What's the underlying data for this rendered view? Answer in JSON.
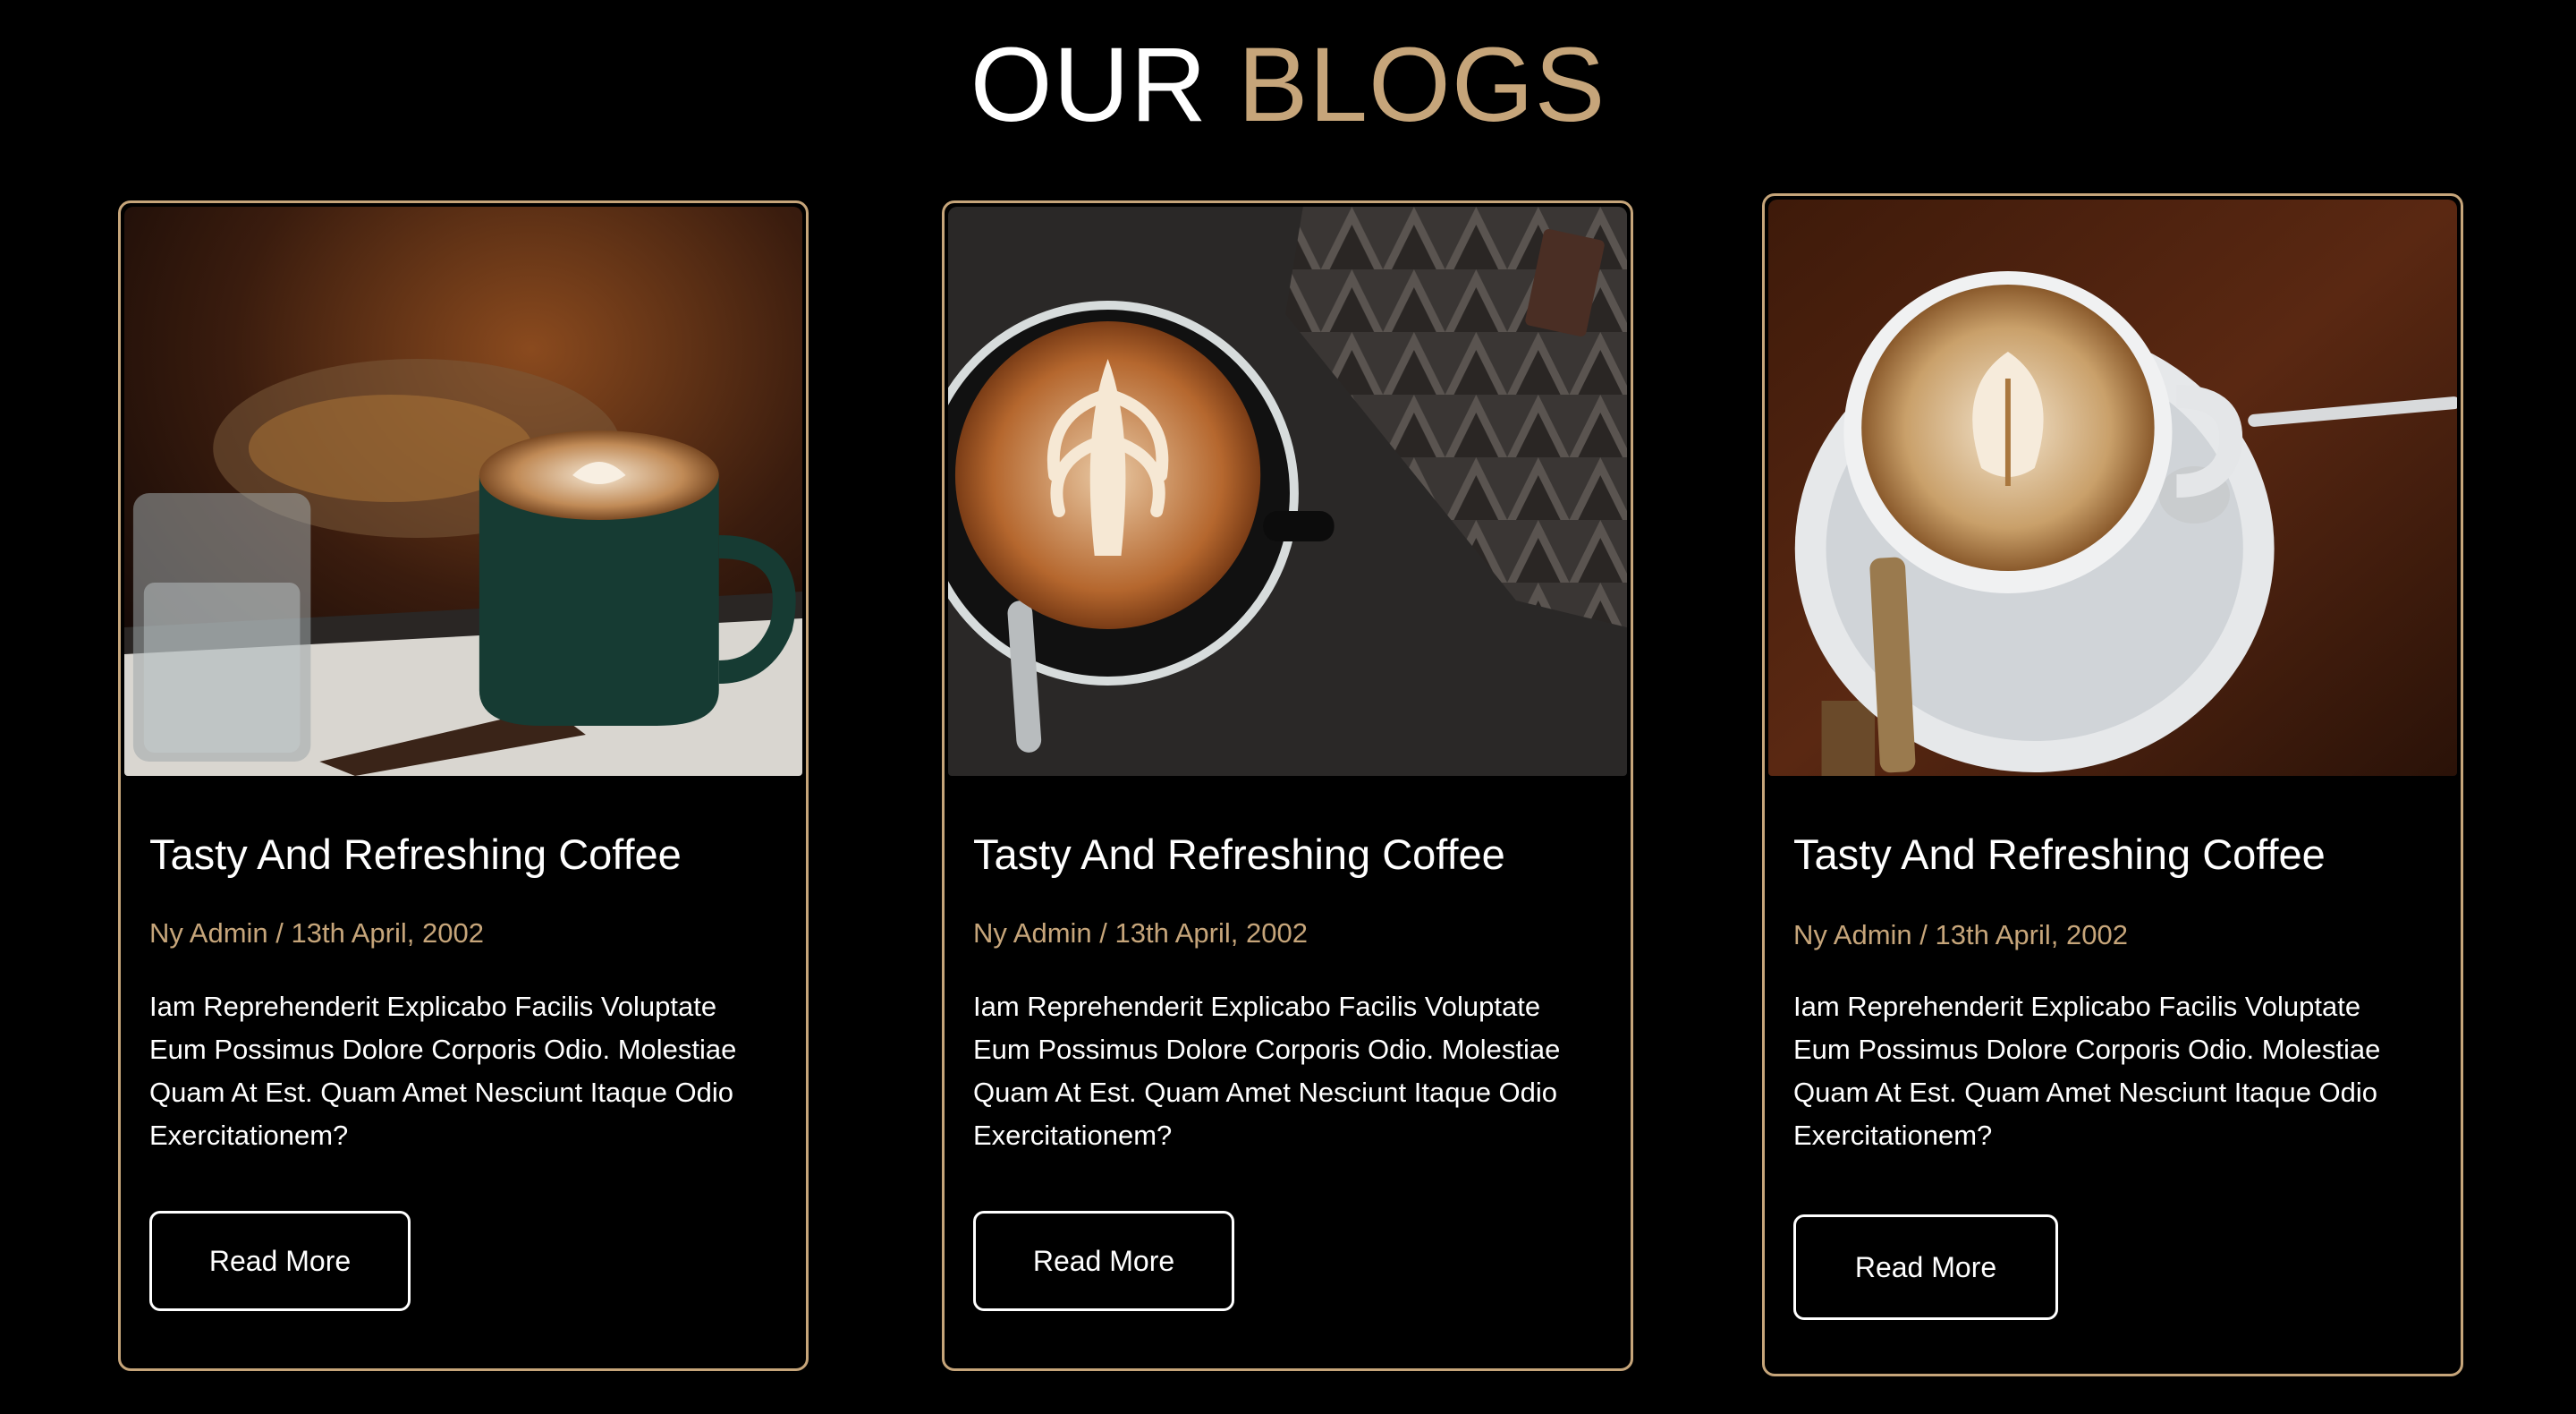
{
  "section": {
    "title_part1": "OUR",
    "title_part2": "BLOGS"
  },
  "colors": {
    "accent": "#c6a57a",
    "background": "#000000",
    "text": "#ffffff"
  },
  "blogs": [
    {
      "image": "coffee-cup-with-water-glass-photo",
      "title": "Tasty And Refreshing Coffee",
      "meta": "Ny Admin / 13th April, 2002",
      "text": "Iam Reprehenderit Explicabo Facilis Voluptate Eum Possimus Dolore Corporis Odio. Molestiae Quam At Est. Quam Amet Nesciunt Itaque Odio Exercitationem?",
      "button": "Read More"
    },
    {
      "image": "latte-art-top-view-photo",
      "title": "Tasty And Refreshing Coffee",
      "meta": "Ny Admin / 13th April, 2002",
      "text": "Iam Reprehenderit Explicabo Facilis Voluptate Eum Possimus Dolore Corporis Odio. Molestiae Quam At Est. Quam Amet Nesciunt Itaque Odio Exercitationem?",
      "button": "Read More"
    },
    {
      "image": "cappuccino-with-spoon-photo",
      "title": "Tasty And Refreshing Coffee",
      "meta": "Ny Admin / 13th April, 2002",
      "text": "Iam Reprehenderit Explicabo Facilis Voluptate Eum Possimus Dolore Corporis Odio. Molestiae Quam At Est. Quam Amet Nesciunt Itaque Odio Exercitationem?",
      "button": "Read More"
    }
  ]
}
